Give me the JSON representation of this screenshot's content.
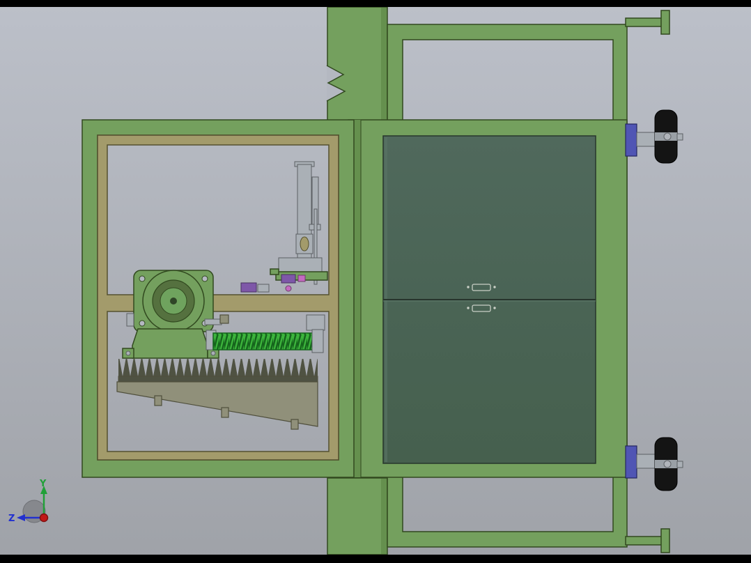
{
  "triad": {
    "y_label": "Y",
    "z_label": "Z"
  },
  "colors": {
    "bg-top": "#bcc0c9",
    "bg-bottom": "#9fa2a8",
    "bg-notch": "#b4b8c1",
    "letterbox": "#000000",
    "frame-green": "#74a05e",
    "frame-green-dark": "#65904e",
    "green-edge": "#31491f",
    "panel-edge": "#27352c",
    "panel-mid": "#4a6455",
    "tan": "#a39b6b",
    "tan-edge": "#55512f",
    "part-gray": "#aab0b6",
    "part-gray-edge": "#5c6064",
    "plate-olive": "#90907a",
    "plate-edge": "#4f4f3c",
    "teeth": "#4f5242",
    "spring-green": "#3cb43c",
    "spring-edge": "#15641c",
    "part-purple": "#7e57a8",
    "part-magenta": "#c46ac0",
    "mount-blue": "#5055b4",
    "mount-blue-edge": "#23255f",
    "wheel-black": "#141414",
    "wheel-hub": "#9aa0a6",
    "axis-green": "#21a038",
    "axis-blue": "#2230cf",
    "axis-red": "#c01818",
    "handle-line": "#c9cfc6"
  }
}
